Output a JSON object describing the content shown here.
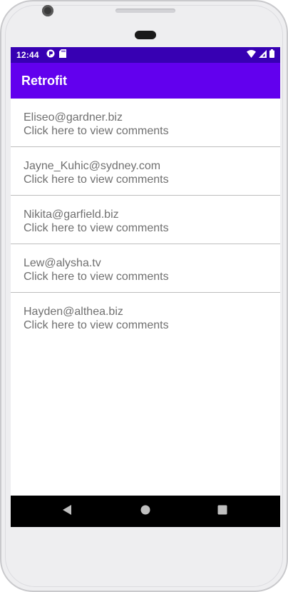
{
  "status_bar": {
    "time": "12:44",
    "left_icons": [
      "sync-icon",
      "sd-card-icon"
    ],
    "right_icons": [
      "wifi-icon",
      "cellular-signal-icon",
      "battery-icon"
    ],
    "color": "#3700b3"
  },
  "app_bar": {
    "title": "Retrofit",
    "color": "#6200ee"
  },
  "list": {
    "items": [
      {
        "email": "Eliseo@gardner.biz",
        "action": "Click here to view comments"
      },
      {
        "email": "Jayne_Kuhic@sydney.com",
        "action": "Click here to view comments"
      },
      {
        "email": "Nikita@garfield.biz",
        "action": "Click here to view comments"
      },
      {
        "email": "Lew@alysha.tv",
        "action": "Click here to view comments"
      },
      {
        "email": "Hayden@althea.biz",
        "action": "Click here to view comments"
      }
    ]
  },
  "nav_bar": {
    "buttons": [
      "back-icon",
      "home-icon",
      "recents-icon"
    ]
  }
}
